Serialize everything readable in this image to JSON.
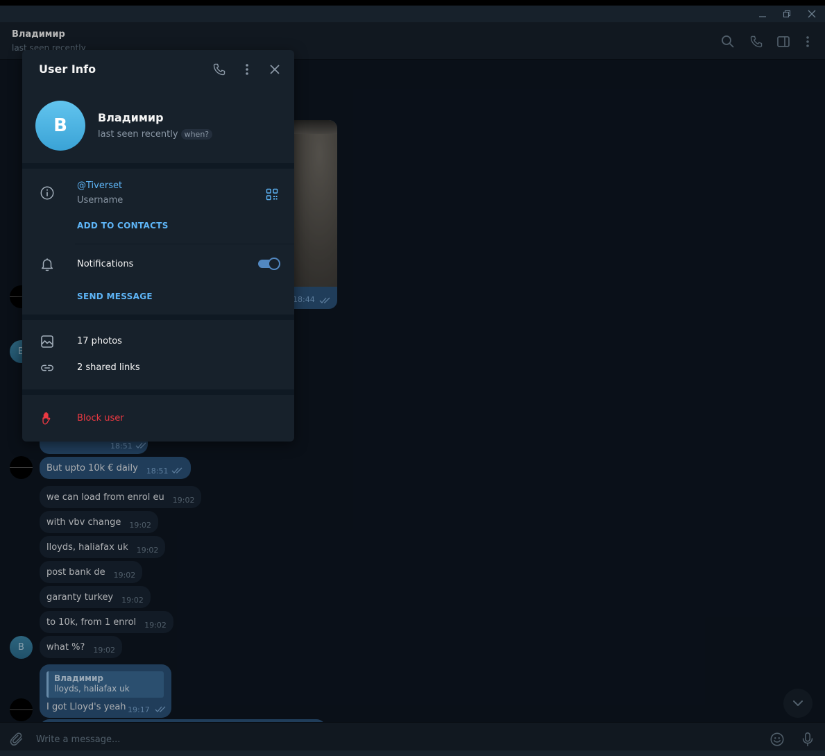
{
  "window": {
    "minimize_label": "minimize",
    "restore_label": "restore",
    "close_label": "close"
  },
  "chat": {
    "title": "Владимир",
    "status": "last seen recently"
  },
  "messages": {
    "photo_time": "18:44",
    "partial_time": "18:51",
    "items": [
      {
        "text": "But upto 10k € daily",
        "time": "18:51"
      },
      {
        "text": "we can load from enrol eu",
        "time": "19:02"
      },
      {
        "text": "with vbv change",
        "time": "19:02"
      },
      {
        "text": "lloyds, haliafax uk",
        "time": "19:02"
      },
      {
        "text": "post bank de",
        "time": "19:02"
      },
      {
        "text": "garanty turkey",
        "time": "19:02"
      },
      {
        "text": "to 10k, from 1 enrol",
        "time": "19:02"
      },
      {
        "text": "what %?",
        "time": "19:02"
      }
    ],
    "reply": {
      "quoted_name": "Владимир",
      "quoted_text": "lloyds, haliafax uk",
      "text": "I got Lloyd's yeah",
      "time": "19:17"
    },
    "avatar_letter": "B"
  },
  "composer": {
    "placeholder": "Write a message..."
  },
  "user_info": {
    "title": "User Info",
    "avatar_letter": "B",
    "name": "Владимир",
    "status": "last seen recently",
    "when_label": "when?",
    "username": "@Tiverset",
    "username_label": "Username",
    "add_to_contacts": "ADD TO CONTACTS",
    "notifications_label": "Notifications",
    "notifications_on": true,
    "send_message": "SEND MESSAGE",
    "photos": "17 photos",
    "shared_links": "2 shared links",
    "block_user": "Block user"
  },
  "colors": {
    "accent": "#5eb5f7",
    "danger": "#ec3942",
    "panel_bg": "#17212b",
    "chat_bg": "#0e1621",
    "outgoing_bubble": "#2b5278",
    "incoming_bubble": "#182533"
  }
}
